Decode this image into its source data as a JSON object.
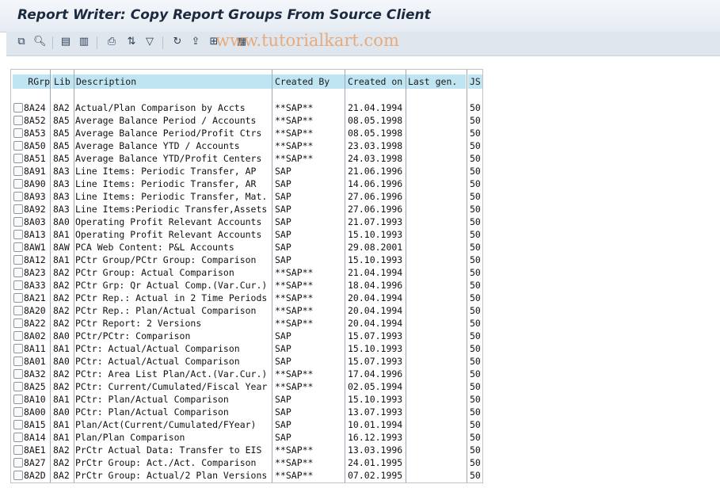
{
  "window": {
    "title": "Report Writer: Copy Report Groups From Source Client"
  },
  "toolbar": {
    "icons": [
      "copy-icon",
      "details-icon",
      "select-all-icon",
      "deselect-all-icon",
      "print-icon",
      "sort-icon",
      "filter-icon",
      "refresh-icon",
      "export-icon",
      "layout-icon",
      "grid-icon"
    ],
    "watermark": "www.tutorialkart.com"
  },
  "table": {
    "columns": [
      "RGrp",
      "Lib",
      "Description",
      "Created By",
      "Created on",
      "Last gen.",
      "JS"
    ],
    "rows": [
      [
        "8A24",
        "8A2",
        "Actual/Plan Comparison by Accts",
        "**SAP**",
        "21.04.1994",
        "",
        "50"
      ],
      [
        "8A52",
        "8A5",
        "Average Balance Period / Accounts",
        "**SAP**",
        "08.05.1998",
        "",
        "50"
      ],
      [
        "8A53",
        "8A5",
        "Average Balance Period/Profit Ctrs",
        "**SAP**",
        "08.05.1998",
        "",
        "50"
      ],
      [
        "8A50",
        "8A5",
        "Average Balance YTD / Accounts",
        "**SAP**",
        "23.03.1998",
        "",
        "50"
      ],
      [
        "8A51",
        "8A5",
        "Average Balance YTD/Profit Centers",
        "**SAP**",
        "24.03.1998",
        "",
        "50"
      ],
      [
        "8A91",
        "8A3",
        "Line Items: Periodic Transfer, AP",
        "SAP",
        "21.06.1996",
        "",
        "50"
      ],
      [
        "8A90",
        "8A3",
        "Line Items: Periodic Transfer, AR",
        "SAP",
        "14.06.1996",
        "",
        "50"
      ],
      [
        "8A93",
        "8A3",
        "Line Items: Periodic Transfer, Mat.",
        "SAP",
        "27.06.1996",
        "",
        "50"
      ],
      [
        "8A92",
        "8A3",
        "Line Items:Periodic Transfer,Assets",
        "SAP",
        "27.06.1996",
        "",
        "50"
      ],
      [
        "8A03",
        "8A0",
        "Operating Profit Relevant Accounts",
        "SAP",
        "21.07.1993",
        "",
        "50"
      ],
      [
        "8A13",
        "8A1",
        "Operating Profit Relevant Accounts",
        "SAP",
        "15.10.1993",
        "",
        "50"
      ],
      [
        "8AW1",
        "8AW",
        "PCA Web Content: P&L Accounts",
        "SAP",
        "29.08.2001",
        "",
        "50"
      ],
      [
        "8A12",
        "8A1",
        "PCtr Group/PCtr Group: Comparison",
        "SAP",
        "15.10.1993",
        "",
        "50"
      ],
      [
        "8A23",
        "8A2",
        "PCtr Group: Actual Comparison",
        "**SAP**",
        "21.04.1994",
        "",
        "50"
      ],
      [
        "8A33",
        "8A2",
        "PCtr Grp: Qr Actual Comp.(Var.Cur.)",
        "**SAP**",
        "18.04.1996",
        "",
        "50"
      ],
      [
        "8A21",
        "8A2",
        "PCtr Rep.: Actual in 2 Time Periods",
        "**SAP**",
        "20.04.1994",
        "",
        "50"
      ],
      [
        "8A20",
        "8A2",
        "PCtr Rep.: Plan/Actual Comparison",
        "**SAP**",
        "20.04.1994",
        "",
        "50"
      ],
      [
        "8A22",
        "8A2",
        "PCtr Report: 2 Versions",
        "**SAP**",
        "20.04.1994",
        "",
        "50"
      ],
      [
        "8A02",
        "8A0",
        "PCtr/PCtr: Comparison",
        "SAP",
        "15.07.1993",
        "",
        "50"
      ],
      [
        "8A11",
        "8A1",
        "PCtr: Actual/Actual Comparison",
        "SAP",
        "15.10.1993",
        "",
        "50"
      ],
      [
        "8A01",
        "8A0",
        "PCtr: Actual/Actual Comparison",
        "SAP",
        "15.07.1993",
        "",
        "50"
      ],
      [
        "8A32",
        "8A2",
        "PCtr: Area List Plan/Act.(Var.Cur.)",
        "**SAP**",
        "17.04.1996",
        "",
        "50"
      ],
      [
        "8A25",
        "8A2",
        "PCtr: Current/Cumulated/Fiscal Year",
        "**SAP**",
        "02.05.1994",
        "",
        "50"
      ],
      [
        "8A10",
        "8A1",
        "PCtr: Plan/Actual Comparison",
        "SAP",
        "15.10.1993",
        "",
        "50"
      ],
      [
        "8A00",
        "8A0",
        "PCtr: Plan/Actual Comparison",
        "SAP",
        "13.07.1993",
        "",
        "50"
      ],
      [
        "8A15",
        "8A1",
        "Plan/Act(Current/Cumulated/FYear)",
        "SAP",
        "10.01.1994",
        "",
        "50"
      ],
      [
        "8A14",
        "8A1",
        "Plan/Plan Comparison",
        "SAP",
        "16.12.1993",
        "",
        "50"
      ],
      [
        "8AE1",
        "8A2",
        "PrCtr Actual Data: Transfer to EIS",
        "**SAP**",
        "13.03.1996",
        "",
        "50"
      ],
      [
        "8A27",
        "8A2",
        "PrCtr Group: Act./Act. Comparison",
        "**SAP**",
        "24.01.1995",
        "",
        "50"
      ],
      [
        "8A2D",
        "8A2",
        "PrCtr Group: Actual/2 Plan Versions",
        "**SAP**",
        "07.02.1995",
        "",
        "50"
      ]
    ]
  }
}
